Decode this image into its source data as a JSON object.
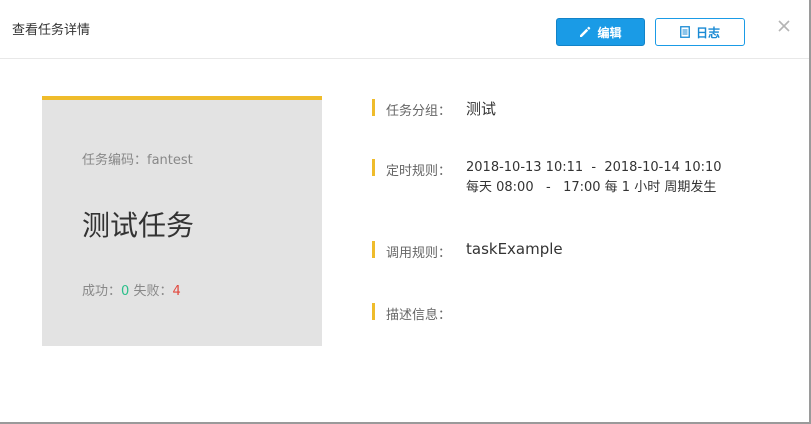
{
  "dialog": {
    "title": "查看任务详情",
    "edit_label": "编辑",
    "log_label": "日志",
    "close_glyph": "×"
  },
  "card": {
    "code_label": "任务编码：",
    "code_value": "fantest",
    "task_name": "测试任务",
    "success_label": "成功：",
    "success_count": "0",
    "fail_label": "失败：",
    "fail_count": "4"
  },
  "details": {
    "group": {
      "label": "任务分组：",
      "value": "测试"
    },
    "schedule": {
      "label": "定时规则：",
      "line1": "2018-10-13 10:11  -  2018-10-14 10:10",
      "line2": "每天 08:00   -   17:00 每 1 小时 周期发生"
    },
    "invoke": {
      "label": "调用规则：",
      "value": "taskExample"
    },
    "description": {
      "label": "描述信息：",
      "value": ""
    }
  },
  "colors": {
    "accent_yellow": "#efbc2b",
    "primary_blue": "#1a9be6",
    "success_green": "#2bbf8a",
    "fail_red": "#e2483d",
    "card_bg": "#e3e3e3"
  },
  "icons": {
    "edit": "pencil-icon",
    "log": "document-icon",
    "close": "close-icon"
  }
}
